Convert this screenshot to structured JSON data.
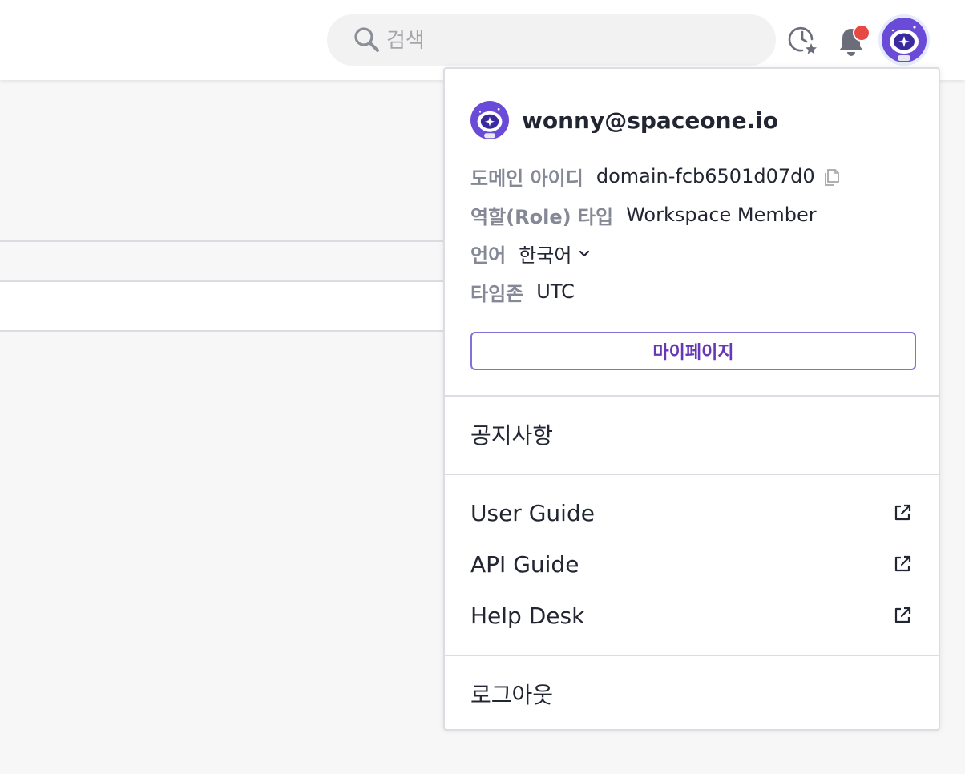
{
  "header": {
    "search": {
      "placeholder": "검색",
      "icon": "search-icon"
    },
    "history_icon": "history-star-icon",
    "notification": {
      "icon": "bell-icon",
      "has_unread": true
    },
    "avatar_icon": "astronaut-avatar-icon"
  },
  "profile_menu": {
    "email": "wonny@spaceone.io",
    "info": [
      {
        "key": "도메인 아이디",
        "value": "domain-fcb6501d07d0"
      },
      {
        "key": "역할(Role) 타입",
        "value": "Workspace Member"
      },
      {
        "key": "언어",
        "value": "한국어"
      },
      {
        "key": "타임존",
        "value": "UTC"
      }
    ],
    "mypage_label": "마이페이지",
    "notice_label": "공지사항",
    "links": [
      {
        "label": "User Guide"
      },
      {
        "label": "API Guide"
      },
      {
        "label": "Help Desk"
      }
    ],
    "logout_label": "로그아웃"
  },
  "colors": {
    "accent": "#6638b6",
    "button_border": "#7f72d8",
    "badge_red": "#e64943",
    "avatar_purple": "#6a4bd8",
    "muted_text": "#858895",
    "divider": "#dcdde2"
  }
}
